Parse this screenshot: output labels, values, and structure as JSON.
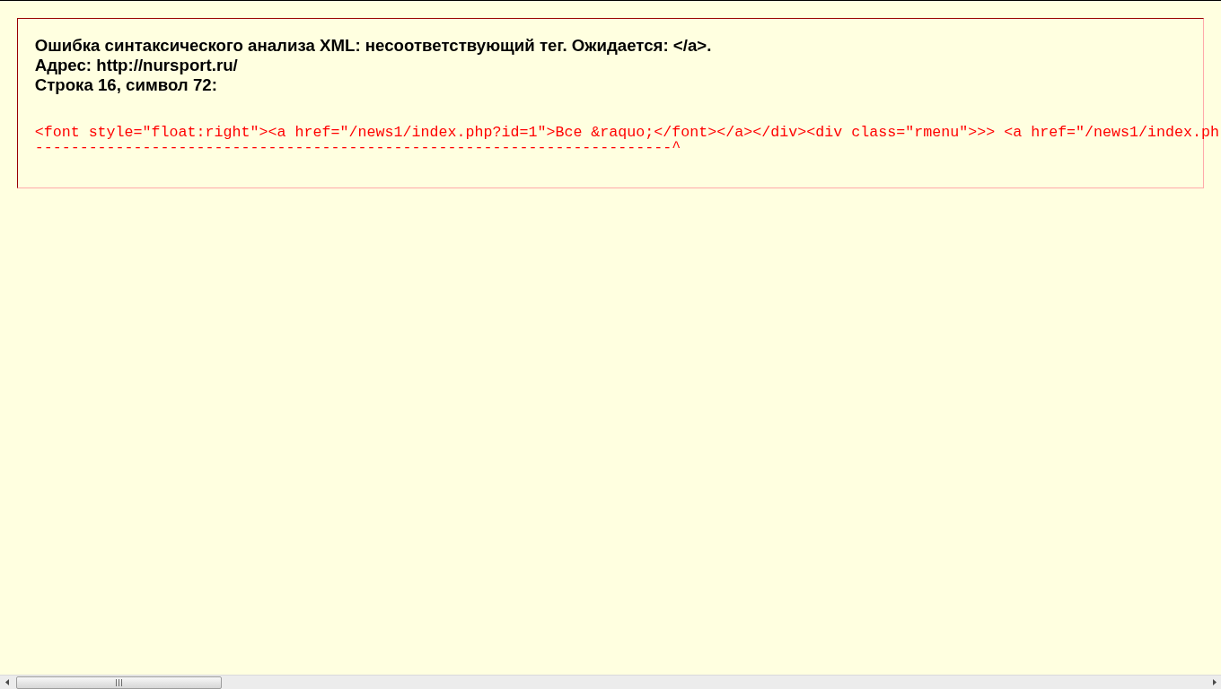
{
  "error": {
    "message": "Ошибка синтаксического анализа XML: несоответствующий тег. Ожидается: </a>.",
    "address": "Адрес: http://nursport.ru/",
    "position": "Строка 16, символ 72:",
    "source_line": "<font style=\"float:right\"><a href=\"/news1/index.php?id=1\">Все &raquo;</font></a></div><div class=\"rmenu\">>> <a href=\"/news1/index.ph",
    "marker_line": "-----------------------------------------------------------------------^"
  }
}
